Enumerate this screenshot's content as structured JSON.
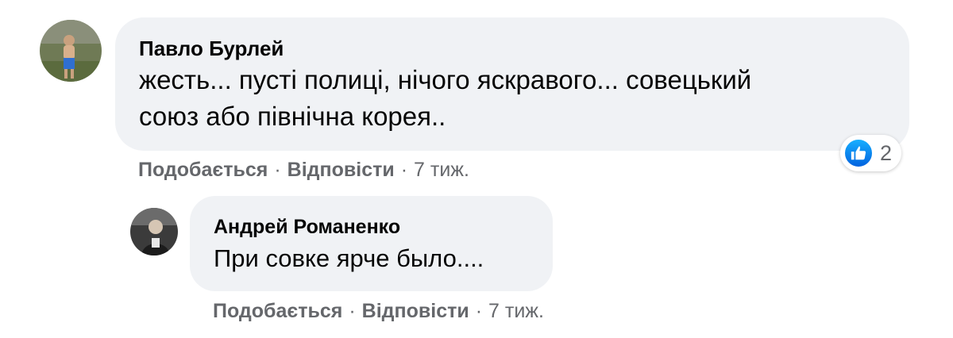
{
  "comments": [
    {
      "author": "Павло Бурлей",
      "text_line1": "жесть... пусті полиці, нічого яскравого... совецький",
      "text_line2": "союз або північна корея..",
      "reaction": {
        "icon": "like-icon",
        "count": "2"
      },
      "actions": {
        "like": "Подобається",
        "reply": "Відповісти",
        "time": "7 тиж."
      }
    },
    {
      "author": "Андрей Романенко",
      "text": "При совке ярче было....",
      "actions": {
        "like": "Подобається",
        "reply": "Відповісти",
        "time": "7 тиж."
      }
    }
  ],
  "separator": "·",
  "colors": {
    "bubble": "#f0f2f5",
    "secondary_text": "#65676b",
    "like_blue": "#0866ff"
  }
}
